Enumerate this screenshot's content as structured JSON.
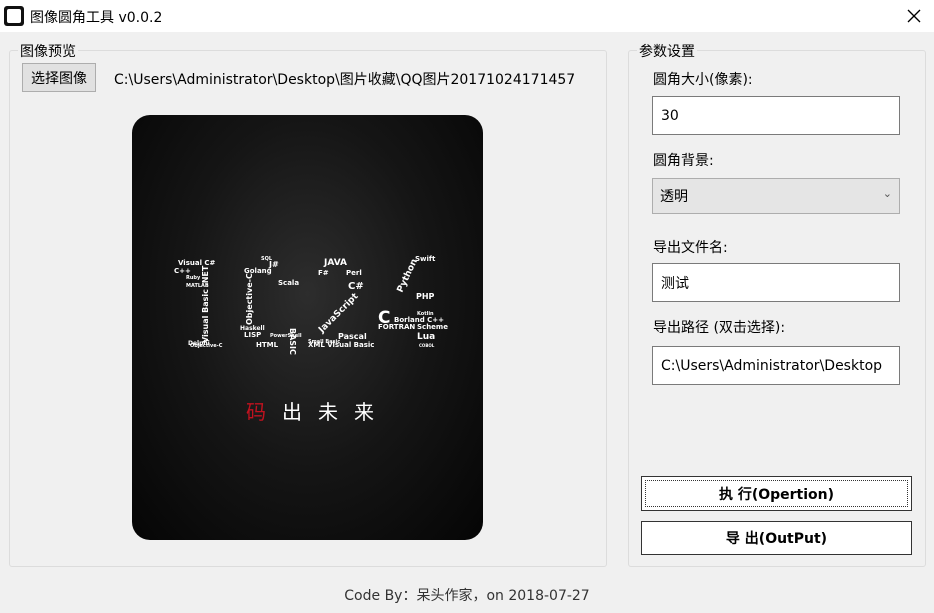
{
  "window": {
    "title": "图像圆角工具 v0.0.2"
  },
  "preview": {
    "group_label": "图像预览",
    "select_button": "选择图像",
    "path": "C:\\Users\\Administrator\\Desktop\\图片收藏\\QQ图片20171024171457",
    "image": {
      "big_text": "1024",
      "slogan": [
        "码",
        "出",
        "未",
        "来"
      ],
      "languages": [
        "Visual C#",
        "C++",
        "J#",
        "SQL",
        "Java",
        "Golang",
        "Scala",
        "Visual Basic .NET",
        "Objective-C",
        "BASIC",
        "LISP",
        "HTML",
        "Delphi",
        "Haskell",
        "PowerShell",
        "JAVA",
        "F#",
        "Perl",
        "C#",
        "JavaScript",
        "ActionScript",
        "Pascal",
        "XML Visual Basic",
        "Swift",
        "Python",
        "PHP",
        "C",
        "Borland C++",
        "FORTRAN",
        "Scheme",
        "Lua",
        "COBOL",
        "Kotlin",
        "Groovy",
        "Erlang",
        "Ruby",
        "MATLAB",
        "Small Basic",
        "VBScript"
      ]
    }
  },
  "settings": {
    "group_label": "参数设置",
    "radius_label": "圆角大小(像素):",
    "radius_value": "30",
    "background_label": "圆角背景:",
    "background_value": "透明",
    "filename_label": "导出文件名:",
    "filename_value": "测试",
    "path_label": "导出路径 (双击选择):",
    "path_value": "C:\\Users\\Administrator\\Desktop",
    "execute_button": "执 行(Opertion)",
    "export_button": "导 出(OutPut)"
  },
  "footer": {
    "text": "Code By：呆头作家，on 2018-07-27"
  }
}
